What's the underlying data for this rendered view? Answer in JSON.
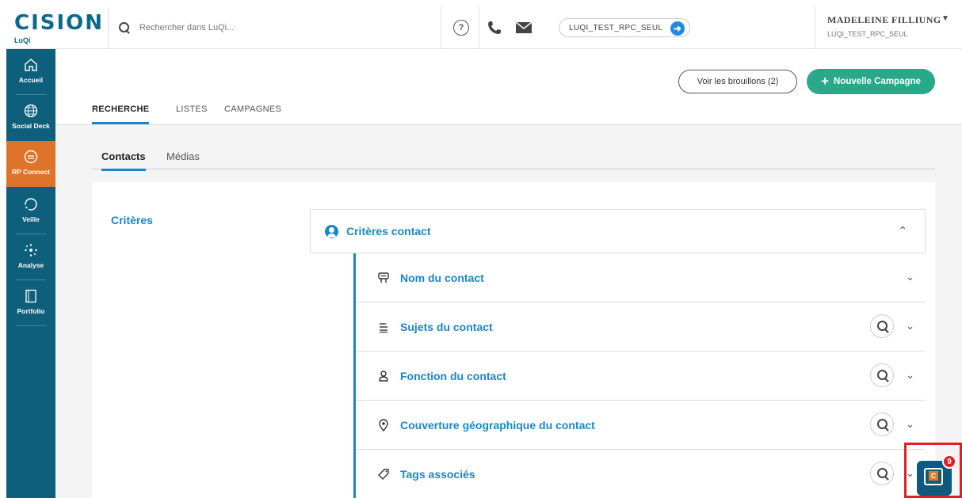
{
  "brand": {
    "logo": "CISION",
    "product": "LuQi"
  },
  "header": {
    "search_placeholder": "Rechercher dans LuQi...",
    "help_label": "?",
    "account_code": "LUQI_TEST_RPC_SEUL",
    "user_name": "MADELEINE FILLIUNG",
    "user_caret": "▼",
    "user_account": "LUQI_TEST_RPC_SEUL"
  },
  "sidebar": {
    "items": [
      {
        "label": "Accueil",
        "icon": "home-icon"
      },
      {
        "label": "Social Deck",
        "icon": "globe-icon"
      },
      {
        "label": "RP Connect",
        "icon": "rp-connect-icon",
        "active": true
      },
      {
        "label": "Veille",
        "icon": "refresh-icon"
      },
      {
        "label": "Analyse",
        "icon": "network-icon"
      },
      {
        "label": "Portfolio",
        "icon": "portfolio-icon"
      }
    ]
  },
  "actions": {
    "drafts": "Voir les brouillons (2)",
    "new_campaign": "Nouvelle Campagne"
  },
  "tabs": [
    "RECHERCHE",
    "LISTES",
    "CAMPAGNES"
  ],
  "subtabs": [
    "Contacts",
    "Médias"
  ],
  "criteria": {
    "label": "Critères",
    "section_title": "Critères contact",
    "rows": [
      {
        "name": "Nom du contact",
        "icon": "badge-icon",
        "has_search": false
      },
      {
        "name": "Sujets du contact",
        "icon": "list-icon",
        "has_search": true
      },
      {
        "name": "Fonction du contact",
        "icon": "person-icon",
        "has_search": true
      },
      {
        "name": "Couverture géographique du contact",
        "icon": "location-pin-icon",
        "has_search": true
      },
      {
        "name": "Tags associés",
        "icon": "tag-icon",
        "has_search": true
      }
    ]
  },
  "chat": {
    "badge": "9",
    "letter": "C"
  },
  "colors": {
    "sidebar": "#0e5f7c",
    "active": "#e0732a",
    "accent": "#1a86c7",
    "green": "#2aa88a",
    "highlight": "#e02020"
  }
}
